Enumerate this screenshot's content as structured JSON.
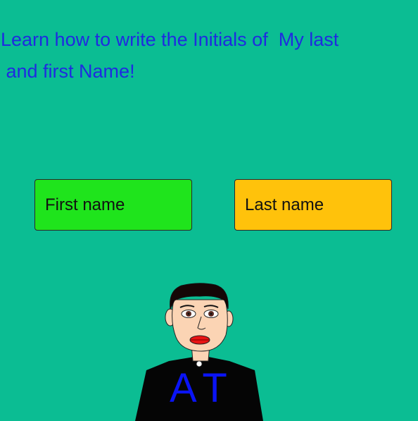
{
  "heading": {
    "line1": "Learn how to write the Initials of  My last",
    "line2": " and first Name!"
  },
  "buttons": {
    "first": "First name",
    "last": "Last name"
  },
  "character": {
    "initials": "AT"
  },
  "colors": {
    "background": "#0bbd93",
    "heading": "#1f2be0",
    "first_button": "#1fe41c",
    "last_button": "#ffc20b",
    "initials": "#0a14f5"
  }
}
